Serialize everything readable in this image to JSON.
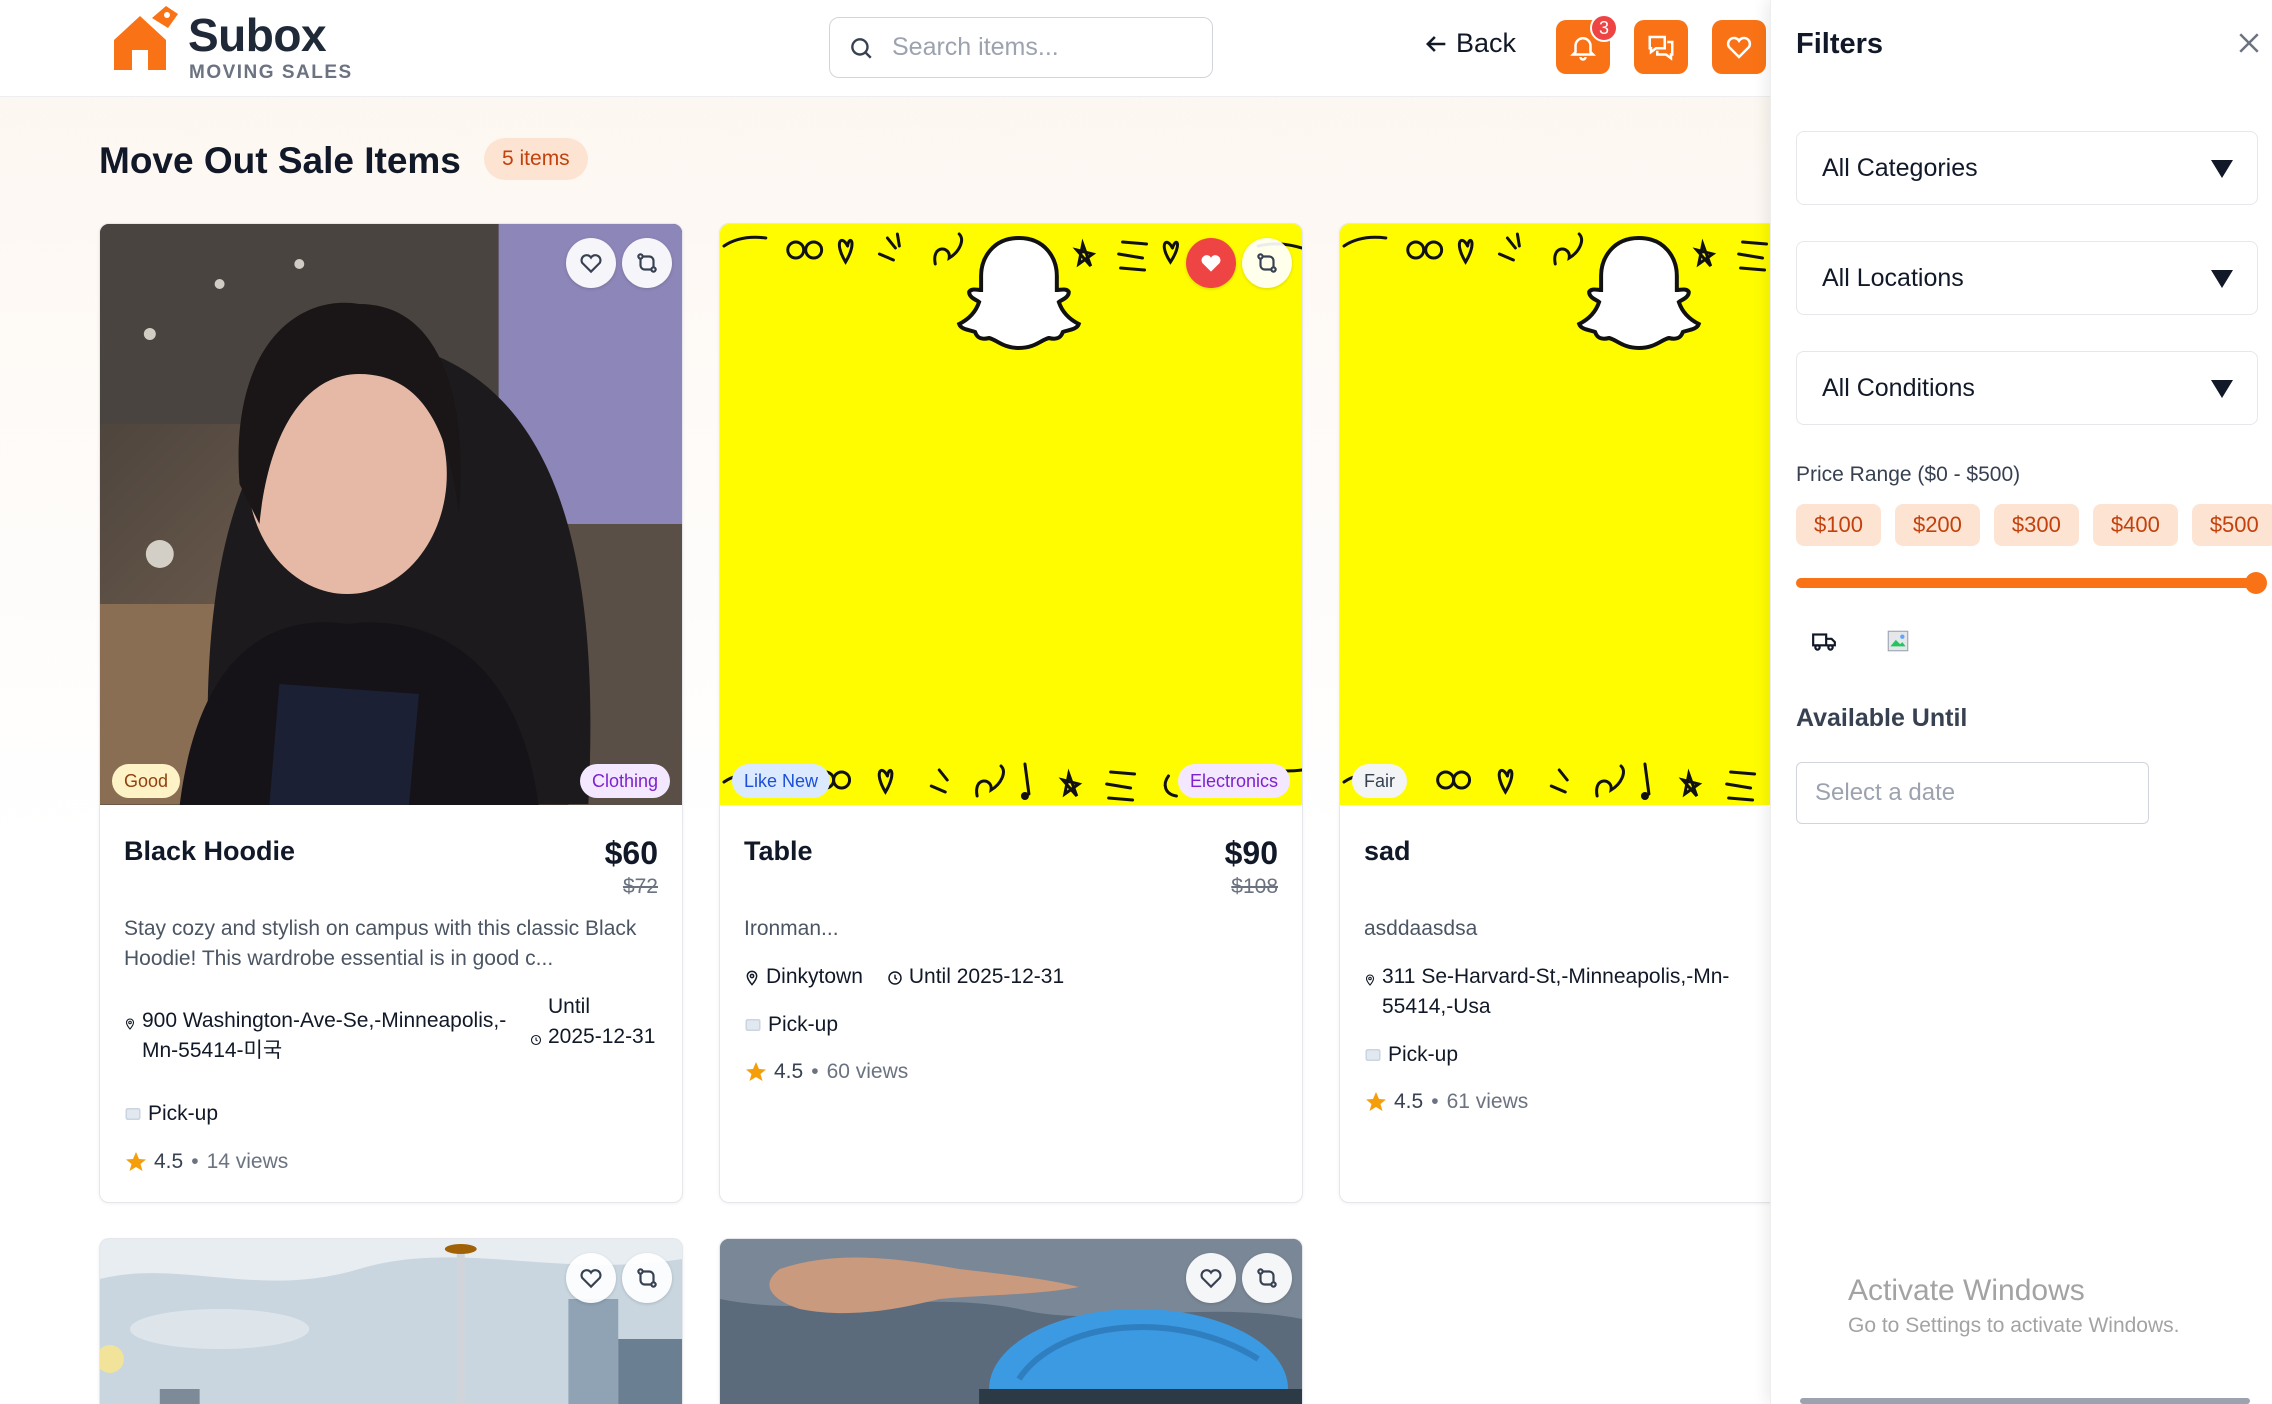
{
  "header": {
    "brand": "Subox",
    "brand_sub": "MOVING SALES",
    "search_placeholder": "Search items...",
    "back_label": "Back",
    "notification_count": "3",
    "accent": "#f97316"
  },
  "main": {
    "title": "Move Out Sale Items",
    "count": "5 items"
  },
  "items": [
    {
      "title": "Black Hoodie",
      "price": "$60",
      "original_price": "$72",
      "description": "Stay cozy and stylish on campus with this classic Black Hoodie! This wardrobe essential is in good c...",
      "address": "900 Washington-Ave-Se,-Minneapolis,-Mn-55414-미국",
      "until_label": "Until",
      "until_date": "2025-12-31",
      "delivery": "Pick-up",
      "rating": "4.5",
      "views": "14 views",
      "condition": "Good",
      "category": "Clothing",
      "liked": false
    },
    {
      "title": "Table",
      "price": "$90",
      "original_price": "$108",
      "description": "Ironman...",
      "address": "Dinkytown",
      "until": "Until 2025-12-31",
      "delivery": "Pick-up",
      "rating": "4.5",
      "views": "60 views",
      "condition": "Like New",
      "category": "Electronics",
      "liked": true
    },
    {
      "title": "sad",
      "description": "asddaasdsa",
      "address": "311 Se-Harvard-St,-Minneapolis,-Mn-55414,-Usa",
      "delivery": "Pick-up",
      "rating": "4.5",
      "views": "61 views",
      "condition": "Fair",
      "liked": false
    }
  ],
  "filters": {
    "title": "Filters",
    "category": "All Categories",
    "location": "All Locations",
    "condition": "All Conditions",
    "price_label": "Price Range ($0 - $500)",
    "price_chips": [
      "$100",
      "$200",
      "$300",
      "$400",
      "$500"
    ],
    "price_max_fraction": 1.0,
    "available_label": "Available Until",
    "date_placeholder": "Select a date"
  },
  "watermark": {
    "line1": "Activate Windows",
    "line2": "Go to Settings to activate Windows."
  }
}
